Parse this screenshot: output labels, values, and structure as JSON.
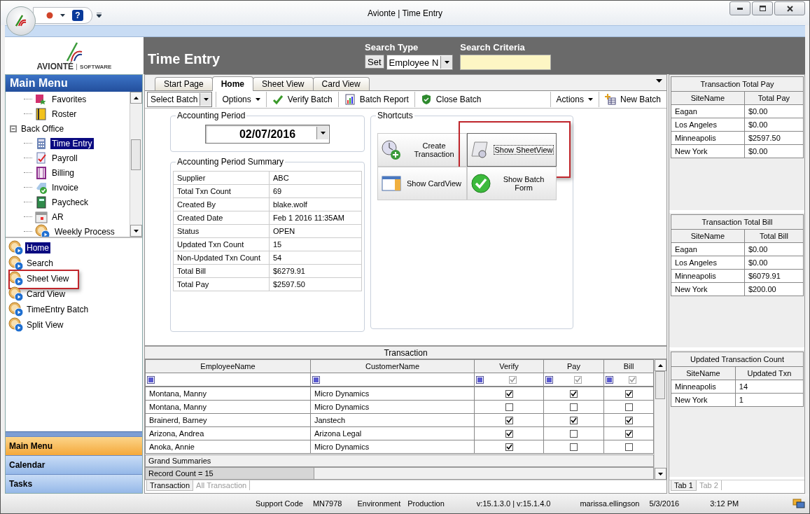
{
  "window": {
    "title": "Avionte | Time Entry"
  },
  "quick_access": {
    "help": "?"
  },
  "logo": {
    "brand": "AVIONTÉ",
    "tagline": "SOFTWARE"
  },
  "header": {
    "title": "Time Entry",
    "search_type_label": "Search Type",
    "set_button": "Set",
    "search_type_value": "Employee N",
    "search_criteria_label": "Search Criteria"
  },
  "sidebar": {
    "title": "Main Menu",
    "menu_tree": [
      {
        "label": "Favorites",
        "selected": false
      },
      {
        "label": "Roster",
        "selected": false
      },
      {
        "label": "Back Office",
        "selected": false,
        "expanded": true,
        "children": [
          {
            "label": "Time Entry",
            "selected": true
          },
          {
            "label": "Payroll",
            "selected": false
          },
          {
            "label": "Billing",
            "selected": false
          },
          {
            "label": "Invoice",
            "selected": false
          },
          {
            "label": "Paycheck",
            "selected": false
          },
          {
            "label": "AR",
            "selected": false
          },
          {
            "label": "Weekly Process",
            "selected": false
          }
        ]
      }
    ],
    "nav_items": [
      {
        "label": "Home",
        "selected": true,
        "highlighted": false
      },
      {
        "label": "Search",
        "selected": false,
        "highlighted": false
      },
      {
        "label": "Sheet View",
        "selected": false,
        "highlighted": true
      },
      {
        "label": "Card View",
        "selected": false,
        "highlighted": false
      },
      {
        "label": "TimeEntry Batch",
        "selected": false,
        "highlighted": false
      },
      {
        "label": "Split View",
        "selected": false,
        "highlighted": false
      }
    ],
    "sections": [
      {
        "label": "Main Menu",
        "selected": true
      },
      {
        "label": "Calendar",
        "selected": false
      },
      {
        "label": "Tasks",
        "selected": false
      }
    ]
  },
  "tabs": [
    {
      "label": "Start Page",
      "selected": false
    },
    {
      "label": "Home",
      "selected": true
    },
    {
      "label": "Sheet View",
      "selected": false
    },
    {
      "label": "Card View",
      "selected": false
    }
  ],
  "toolbar": [
    {
      "label": "Select Batch",
      "kind": "dropdown"
    },
    {
      "label": "Options",
      "kind": "menu"
    },
    {
      "label": "Verify Batch",
      "kind": "verify"
    },
    {
      "label": "Batch Report",
      "kind": "report"
    },
    {
      "label": "Close Batch",
      "kind": "close"
    },
    {
      "label": "Actions",
      "kind": "menu-right"
    },
    {
      "label": "New Batch",
      "kind": "new"
    }
  ],
  "accounting_period": {
    "title": "Accounting Period",
    "date": "02/07/2016"
  },
  "summary": {
    "title": "Accounting Period Summary",
    "rows": [
      {
        "label": "Supplier",
        "value": "ABC"
      },
      {
        "label": "Total Txn Count",
        "value": "69"
      },
      {
        "label": "Created By",
        "value": "blake.wolf"
      },
      {
        "label": "Created Date",
        "value": "Feb  1 2016 11:35AM"
      },
      {
        "label": "Status",
        "value": "OPEN"
      },
      {
        "label": "Updated Txn Count",
        "value": "15"
      },
      {
        "label": "Non-Updated Txn Count",
        "value": "54"
      },
      {
        "label": "Total Bill",
        "value": "$6279.91"
      },
      {
        "label": "Total Pay",
        "value": "$2597.50"
      }
    ]
  },
  "shortcuts": {
    "title": "Shortcuts",
    "buttons": [
      {
        "label": "Create Transaction",
        "kind": "create",
        "highlighted": false,
        "focused": false
      },
      {
        "label": "Show SheetView",
        "kind": "sheet",
        "highlighted": true,
        "focused": true
      },
      {
        "label": "Show CardView",
        "kind": "card",
        "highlighted": false,
        "focused": false
      },
      {
        "label": "Show Batch Form",
        "kind": "batch",
        "highlighted": false,
        "focused": false
      }
    ]
  },
  "transaction": {
    "title": "Transaction",
    "columns": [
      {
        "label": "EmployeeName",
        "kind": "text"
      },
      {
        "label": "CustomerName",
        "kind": "text"
      },
      {
        "label": "Verify",
        "kind": "check",
        "filter_checked": true
      },
      {
        "label": "Pay",
        "kind": "check",
        "filter_checked": true
      },
      {
        "label": "Bill",
        "kind": "check",
        "filter_checked": true
      }
    ],
    "rows": [
      {
        "employee": "Montana, Manny",
        "customer": "Micro Dynamics",
        "verify": true,
        "pay": true,
        "bill": true
      },
      {
        "employee": "Montana, Manny",
        "customer": "Micro Dynamics",
        "verify": false,
        "pay": false,
        "bill": false
      },
      {
        "employee": "Brainerd, Barney",
        "customer": "Janstech",
        "verify": true,
        "pay": true,
        "bill": true
      },
      {
        "employee": "Arizona, Andrea",
        "customer": "Arizona Legal",
        "verify": true,
        "pay": false,
        "bill": true
      },
      {
        "employee": "Anoka, Annie",
        "customer": "Micro Dynamics",
        "verify": true,
        "pay": false,
        "bill": false
      }
    ],
    "grand_summaries": "Grand Summaries",
    "record_count": "Record Count = 15",
    "tabs": [
      {
        "label": "Transaction",
        "selected": true
      },
      {
        "label": "All Transaction",
        "selected": false
      }
    ]
  },
  "side_panels": [
    {
      "title": "Transaction Total Pay",
      "columns": [
        "SiteName",
        "Total Pay"
      ],
      "rows": [
        [
          "Eagan",
          "$0.00"
        ],
        [
          "Los Angeles",
          "$0.00"
        ],
        [
          "Minneapolis",
          "$2597.50"
        ],
        [
          "New York",
          "$0.00"
        ]
      ]
    },
    {
      "title": "Transaction Total Bill",
      "columns": [
        "SiteName",
        "Total Bill"
      ],
      "rows": [
        [
          "Eagan",
          "$0.00"
        ],
        [
          "Los Angeles",
          "$0.00"
        ],
        [
          "Minneapolis",
          "$6079.91"
        ],
        [
          "New York",
          "$200.00"
        ]
      ]
    },
    {
      "title": "Updated Transaction Count",
      "columns": [
        "SiteName",
        "Updated Txn"
      ],
      "rows": [
        [
          "Minneapolis",
          "14"
        ],
        [
          "New York",
          "1"
        ]
      ]
    }
  ],
  "side_tabs": [
    {
      "label": "Tab 1",
      "selected": true
    },
    {
      "label": "Tab 2",
      "selected": false
    }
  ],
  "status_bar": {
    "support_code_label": "Support Code",
    "support_code": "MN7978",
    "environment_label": "Environment",
    "environment": "Production",
    "version": "v:15.1.3.0 | v:15.1.4.0",
    "user": "marissa.ellingson",
    "date": "5/3/2016",
    "time": "3:12 PM"
  }
}
